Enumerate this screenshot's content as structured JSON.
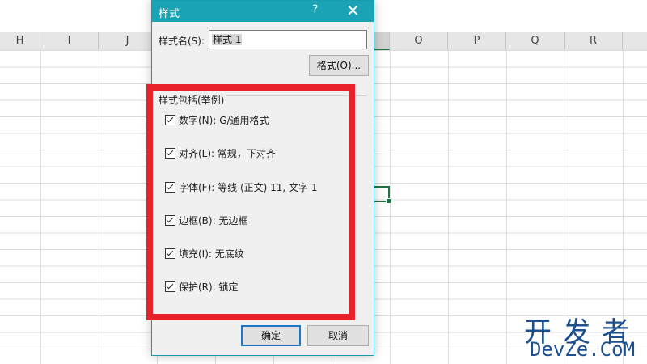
{
  "sheet": {
    "columns": [
      "H",
      "I",
      "J",
      "O",
      "P",
      "Q",
      "R"
    ]
  },
  "dialog": {
    "title": "样式",
    "help": "?",
    "close": "✕",
    "name_label": "样式名(S):",
    "name_value": "样式 1",
    "format_button": "格式(O)...",
    "group_label": "样式包括(举例)",
    "options": [
      {
        "label": "数字(N): G/通用格式",
        "checked": true
      },
      {
        "label": "对齐(L): 常规，下对齐",
        "checked": true
      },
      {
        "label": "字体(F): 等线 (正文) 11, 文字 1",
        "checked": true
      },
      {
        "label": "边框(B): 无边框",
        "checked": true
      },
      {
        "label": "填充(I): 无底纹",
        "checked": true
      },
      {
        "label": "保护(R): 锁定",
        "checked": true
      }
    ],
    "ok_button": "确定",
    "cancel_button": "取消"
  },
  "watermark": {
    "line1": "开发者",
    "line2": "DevZe.CoM"
  },
  "colors": {
    "titlebar": "#1aa3b4",
    "highlight": "#e8202a",
    "excel_green": "#217346",
    "watermark": "#1b4f8f"
  }
}
